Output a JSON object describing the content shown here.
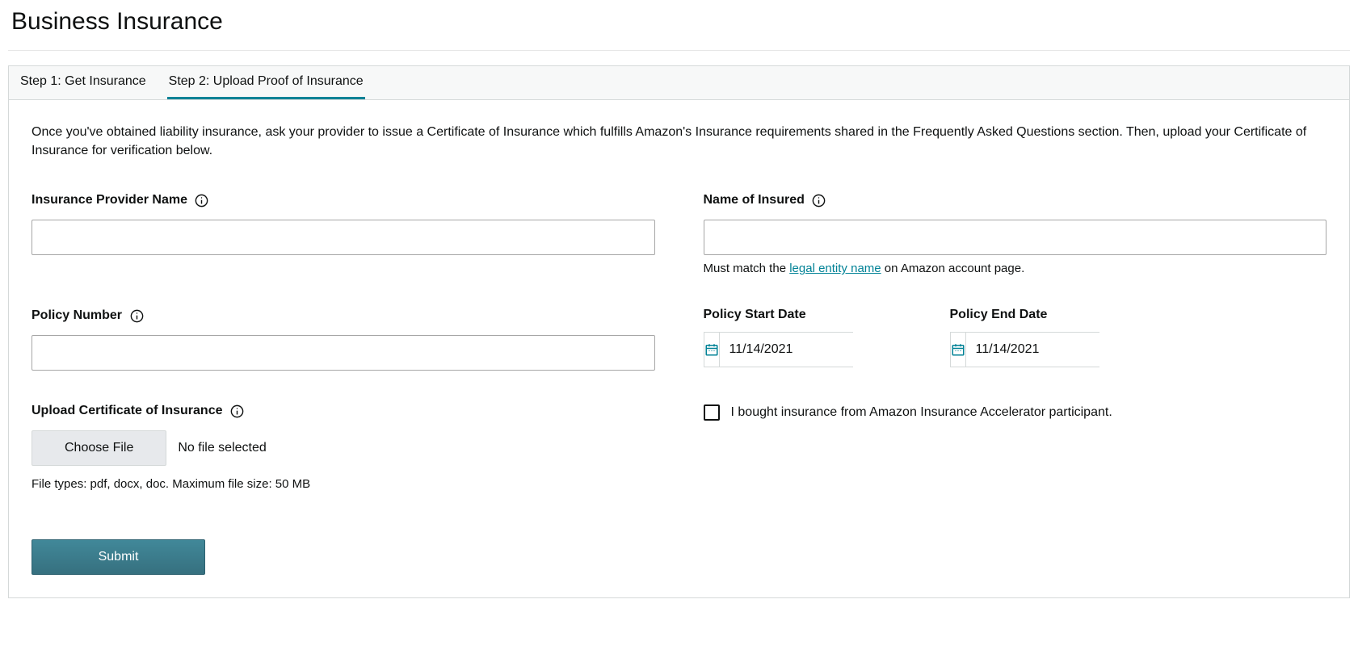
{
  "page_title": "Business Insurance",
  "tabs": [
    {
      "label": "Step 1: Get Insurance",
      "active": false
    },
    {
      "label": "Step 2: Upload Proof of Insurance",
      "active": true
    }
  ],
  "intro": "Once you've obtained liability insurance, ask your provider to issue a Certificate of Insurance which fulfills Amazon's Insurance requirements shared in the Frequently Asked Questions section. Then, upload your Certificate of Insurance for verification below.",
  "fields": {
    "provider_name": {
      "label": "Insurance Provider Name",
      "value": ""
    },
    "insured_name": {
      "label": "Name of Insured",
      "value": "",
      "help_prefix": "Must match the ",
      "help_link": "legal entity name",
      "help_suffix": " on Amazon account page."
    },
    "policy_number": {
      "label": "Policy Number",
      "value": ""
    },
    "start_date": {
      "label": "Policy Start Date",
      "value": "11/14/2021"
    },
    "end_date": {
      "label": "Policy End Date",
      "value": "11/14/2021"
    },
    "upload": {
      "label": "Upload Certificate of Insurance",
      "button": "Choose File",
      "status": "No file selected",
      "hint": "File types: pdf, docx, doc. Maximum file size: 50 MB"
    },
    "accelerator_checkbox": {
      "label": "I bought insurance from Amazon Insurance Accelerator participant.",
      "checked": false
    }
  },
  "submit_label": "Submit"
}
